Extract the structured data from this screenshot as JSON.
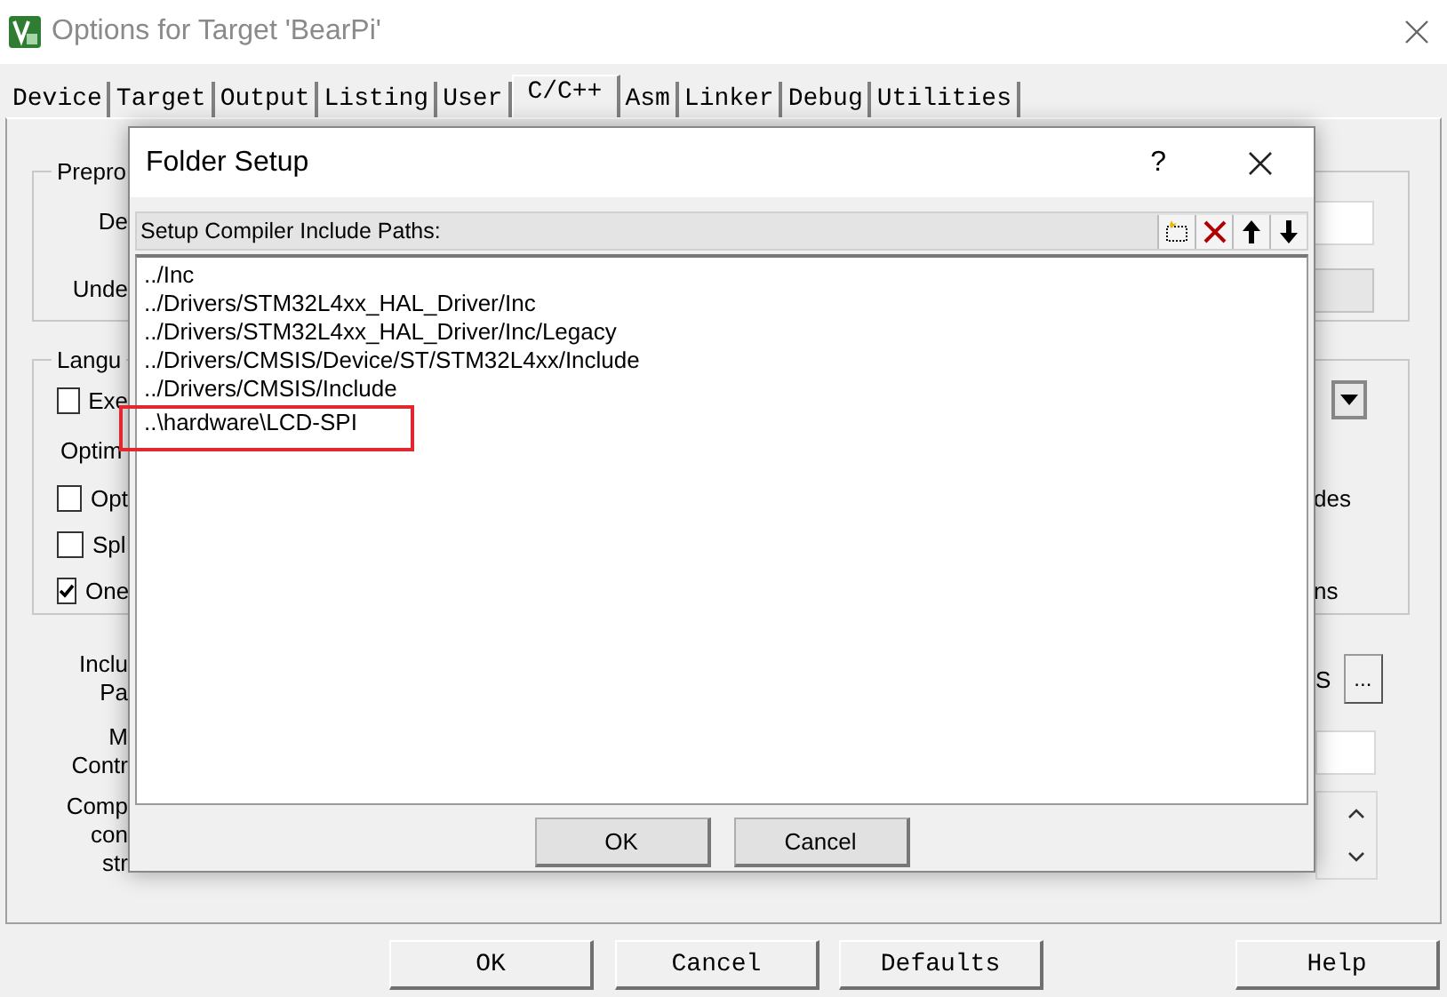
{
  "window": {
    "title": "Options for Target 'BearPi'"
  },
  "tabs": [
    {
      "label": "Device",
      "selected": false
    },
    {
      "label": "Target",
      "selected": false
    },
    {
      "label": "Output",
      "selected": false
    },
    {
      "label": "Listing",
      "selected": false
    },
    {
      "label": "User",
      "selected": false
    },
    {
      "label": "C/C++",
      "selected": true
    },
    {
      "label": "Asm",
      "selected": false
    },
    {
      "label": "Linker",
      "selected": false
    },
    {
      "label": "Debug",
      "selected": false
    },
    {
      "label": "Utilities",
      "selected": false
    }
  ],
  "panel": {
    "groups": [
      {
        "title": "Prepro",
        "rows": [
          {
            "left": {
              "kind": "label",
              "lines": [
                "De"
              ]
            },
            "right": {
              "kind": "field",
              "enabled": true
            }
          },
          {
            "left": {
              "kind": "label",
              "lines": [
                "Unde"
              ]
            },
            "right": {
              "kind": "field",
              "enabled": false
            }
          }
        ]
      },
      {
        "title": "Langu",
        "rows": [
          {
            "left": {
              "kind": "checkbox",
              "text": "Exe",
              "checked": false
            },
            "right": {
              "kind": "dropdown"
            }
          },
          {
            "left": {
              "kind": "caption",
              "text": "Optim"
            }
          },
          {
            "left": {
              "kind": "checkbox",
              "text": "Opt",
              "checked": false
            },
            "right": {
              "kind": "text",
              "text": "des"
            }
          },
          {
            "left": {
              "kind": "checkbox",
              "text": "Spl",
              "checked": false
            }
          },
          {
            "left": {
              "kind": "checkbox",
              "text": "One",
              "checked": true
            },
            "right": {
              "kind": "text",
              "text": "ns"
            }
          }
        ]
      }
    ],
    "rows": [
      {
        "left": {
          "kind": "label",
          "lines": [
            "Inclu",
            "Pa"
          ]
        },
        "right": {
          "kind": "browse",
          "text": "S",
          "button": "..."
        }
      },
      {
        "left": {
          "kind": "label",
          "lines": [
            "M",
            "Contr"
          ]
        },
        "right": {
          "kind": "field",
          "enabled": true
        }
      },
      {
        "left": {
          "kind": "label",
          "lines": [
            "Comp",
            "con",
            "str"
          ]
        },
        "right": {
          "kind": "textarea"
        }
      }
    ]
  },
  "dialog": {
    "title": "Folder Setup",
    "help": "?",
    "header": "Setup Compiler Include Paths:",
    "paths": [
      {
        "text": "../Inc",
        "highlighted": false
      },
      {
        "text": "../Drivers/STM32L4xx_HAL_Driver/Inc",
        "highlighted": false
      },
      {
        "text": "../Drivers/STM32L4xx_HAL_Driver/Inc/Legacy",
        "highlighted": false
      },
      {
        "text": "../Drivers/CMSIS/Device/ST/STM32L4xx/Include",
        "highlighted": false
      },
      {
        "text": "../Drivers/CMSIS/Include",
        "highlighted": false
      },
      {
        "text": "..\\hardware\\LCD-SPI",
        "highlighted": true
      }
    ],
    "buttons": [
      "OK",
      "Cancel"
    ]
  },
  "buttons": [
    "OK",
    "Cancel",
    "Defaults",
    "Help"
  ]
}
